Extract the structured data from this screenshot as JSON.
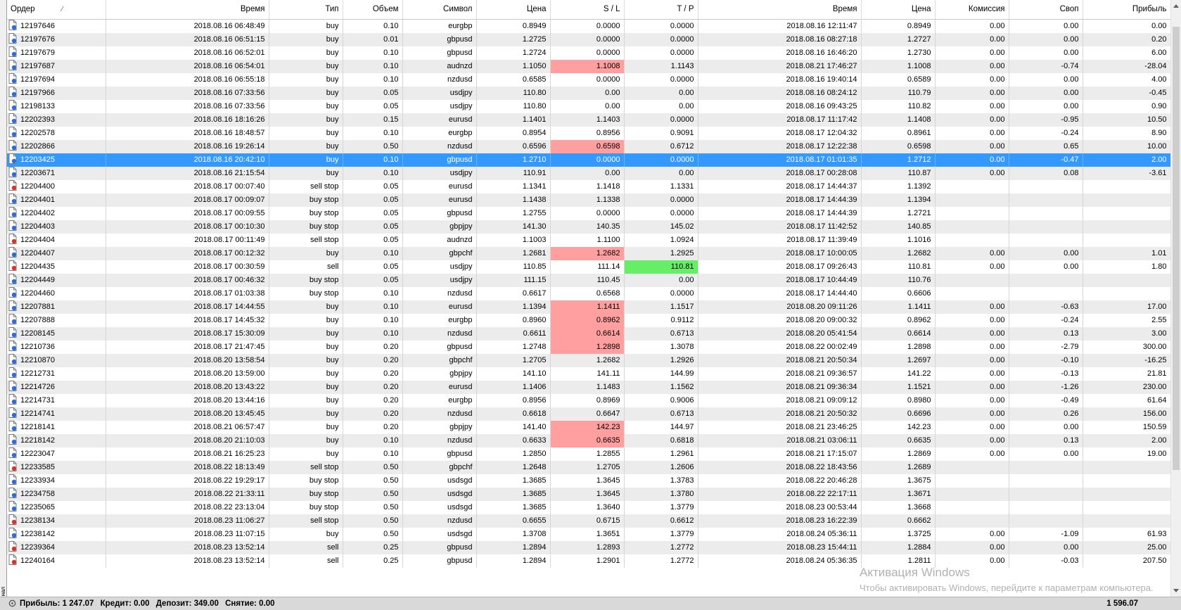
{
  "side_tab": {
    "label": "инал"
  },
  "columns": [
    {
      "key": "order",
      "label": "Ордер",
      "width": 140
    },
    {
      "key": "open_time",
      "label": "Время",
      "width": 232
    },
    {
      "key": "type",
      "label": "Тип",
      "width": 105
    },
    {
      "key": "volume",
      "label": "Объем",
      "width": 85
    },
    {
      "key": "symbol",
      "label": "Символ",
      "width": 105
    },
    {
      "key": "price",
      "label": "Цена",
      "width": 105
    },
    {
      "key": "sl",
      "label": "S / L",
      "width": 105
    },
    {
      "key": "tp",
      "label": "T / P",
      "width": 105
    },
    {
      "key": "close_time",
      "label": "Время",
      "width": 232
    },
    {
      "key": "close_price",
      "label": "Цена",
      "width": 105
    },
    {
      "key": "commission",
      "label": "Комиссия",
      "width": 105
    },
    {
      "key": "swap",
      "label": "Своп",
      "width": 105
    },
    {
      "key": "profit",
      "label": "Прибыль",
      "width": 125
    }
  ],
  "sort_indicator": "⁄",
  "rows": [
    {
      "order": "12197646",
      "open_time": "2018.08.16 06:48:49",
      "type": "buy",
      "volume": "0.10",
      "symbol": "eurgbp",
      "price": "0.8949",
      "sl": "0.0000",
      "tp": "0.0000",
      "close_time": "2018.08.16 12:11:47",
      "close_price": "0.8949",
      "commission": "0.00",
      "swap": "0.00",
      "profit": "0.00"
    },
    {
      "order": "12197676",
      "open_time": "2018.08.16 06:51:15",
      "type": "buy",
      "volume": "0.01",
      "symbol": "gbpusd",
      "price": "1.2725",
      "sl": "0.0000",
      "tp": "0.0000",
      "close_time": "2018.08.16 08:27:18",
      "close_price": "1.2727",
      "commission": "0.00",
      "swap": "0.00",
      "profit": "0.20"
    },
    {
      "order": "12197679",
      "open_time": "2018.08.16 06:52:01",
      "type": "buy",
      "volume": "0.10",
      "symbol": "gbpusd",
      "price": "1.2724",
      "sl": "0.0000",
      "tp": "0.0000",
      "close_time": "2018.08.16 16:46:20",
      "close_price": "1.2730",
      "commission": "0.00",
      "swap": "0.00",
      "profit": "6.00"
    },
    {
      "order": "12197687",
      "open_time": "2018.08.16 06:54:01",
      "type": "buy",
      "volume": "0.10",
      "symbol": "audnzd",
      "price": "1.1050",
      "sl": "1.1008",
      "tp": "1.1143",
      "close_time": "2018.08.21 17:46:27",
      "close_price": "1.1008",
      "commission": "0.00",
      "swap": "-0.74",
      "profit": "-28.04",
      "sl_hl": "red"
    },
    {
      "order": "12197694",
      "open_time": "2018.08.16 06:55:18",
      "type": "buy",
      "volume": "0.10",
      "symbol": "nzdusd",
      "price": "0.6585",
      "sl": "0.0000",
      "tp": "0.0000",
      "close_time": "2018.08.16 19:40:14",
      "close_price": "0.6589",
      "commission": "0.00",
      "swap": "0.00",
      "profit": "4.00"
    },
    {
      "order": "12197966",
      "open_time": "2018.08.16 07:33:56",
      "type": "buy",
      "volume": "0.05",
      "symbol": "usdjpy",
      "price": "110.80",
      "sl": "0.00",
      "tp": "0.00",
      "close_time": "2018.08.16 08:24:12",
      "close_price": "110.79",
      "commission": "0.00",
      "swap": "0.00",
      "profit": "-0.45"
    },
    {
      "order": "12198133",
      "open_time": "2018.08.16 07:33:56",
      "type": "buy",
      "volume": "0.05",
      "symbol": "usdjpy",
      "price": "110.80",
      "sl": "0.00",
      "tp": "0.00",
      "close_time": "2018.08.16 09:43:25",
      "close_price": "110.82",
      "commission": "0.00",
      "swap": "0.00",
      "profit": "0.90"
    },
    {
      "order": "12202393",
      "open_time": "2018.08.16 18:16:26",
      "type": "buy",
      "volume": "0.15",
      "symbol": "eurusd",
      "price": "1.1401",
      "sl": "1.1403",
      "tp": "0.0000",
      "close_time": "2018.08.17 11:17:42",
      "close_price": "1.1408",
      "commission": "0.00",
      "swap": "-0.95",
      "profit": "10.50"
    },
    {
      "order": "12202578",
      "open_time": "2018.08.16 18:48:57",
      "type": "buy",
      "volume": "0.10",
      "symbol": "eurgbp",
      "price": "0.8954",
      "sl": "0.8956",
      "tp": "0.9091",
      "close_time": "2018.08.17 12:04:32",
      "close_price": "0.8961",
      "commission": "0.00",
      "swap": "-0.24",
      "profit": "8.90"
    },
    {
      "order": "12202866",
      "open_time": "2018.08.16 19:26:14",
      "type": "buy",
      "volume": "0.50",
      "symbol": "nzdusd",
      "price": "0.6596",
      "sl": "0.6598",
      "tp": "0.6712",
      "close_time": "2018.08.17 12:22:38",
      "close_price": "0.6598",
      "commission": "0.00",
      "swap": "0.65",
      "profit": "10.00",
      "sl_hl": "red"
    },
    {
      "order": "12203425",
      "open_time": "2018.08.16 20:42:10",
      "type": "buy",
      "volume": "0.10",
      "symbol": "gbpusd",
      "price": "1.2710",
      "sl": "0.0000",
      "tp": "0.0000",
      "close_time": "2018.08.17 01:01:35",
      "close_price": "1.2712",
      "commission": "0.00",
      "swap": "-0.47",
      "profit": "2.00",
      "selected": true
    },
    {
      "order": "12203671",
      "open_time": "2018.08.16 21:15:54",
      "type": "buy",
      "volume": "0.10",
      "symbol": "usdjpy",
      "price": "110.91",
      "sl": "0.00",
      "tp": "0.00",
      "close_time": "2018.08.17 00:28:08",
      "close_price": "110.87",
      "commission": "0.00",
      "swap": "0.08",
      "profit": "-3.61"
    },
    {
      "order": "12204400",
      "open_time": "2018.08.17 00:07:40",
      "type": "sell stop",
      "volume": "0.05",
      "symbol": "eurusd",
      "price": "1.1341",
      "sl": "1.1418",
      "tp": "1.1331",
      "close_time": "2018.08.17 14:44:37",
      "close_price": "1.1392",
      "commission": "",
      "swap": "",
      "profit": ""
    },
    {
      "order": "12204401",
      "open_time": "2018.08.17 00:09:07",
      "type": "buy stop",
      "volume": "0.05",
      "symbol": "eurusd",
      "price": "1.1438",
      "sl": "1.1338",
      "tp": "0.0000",
      "close_time": "2018.08.17 14:44:39",
      "close_price": "1.1394",
      "commission": "",
      "swap": "",
      "profit": ""
    },
    {
      "order": "12204402",
      "open_time": "2018.08.17 00:09:55",
      "type": "buy stop",
      "volume": "0.05",
      "symbol": "gbpusd",
      "price": "1.2755",
      "sl": "0.0000",
      "tp": "0.0000",
      "close_time": "2018.08.17 14:44:39",
      "close_price": "1.2721",
      "commission": "",
      "swap": "",
      "profit": ""
    },
    {
      "order": "12204403",
      "open_time": "2018.08.17 00:10:30",
      "type": "buy stop",
      "volume": "0.05",
      "symbol": "gbpjpy",
      "price": "141.30",
      "sl": "140.35",
      "tp": "145.02",
      "close_time": "2018.08.17 11:42:52",
      "close_price": "140.85",
      "commission": "",
      "swap": "",
      "profit": ""
    },
    {
      "order": "12204404",
      "open_time": "2018.08.17 00:11:49",
      "type": "sell stop",
      "volume": "0.05",
      "symbol": "audnzd",
      "price": "1.1003",
      "sl": "1.1100",
      "tp": "1.0924",
      "close_time": "2018.08.17 11:39:49",
      "close_price": "1.1016",
      "commission": "",
      "swap": "",
      "profit": ""
    },
    {
      "order": "12204407",
      "open_time": "2018.08.17 00:12:32",
      "type": "buy",
      "volume": "0.10",
      "symbol": "gbpchf",
      "price": "1.2681",
      "sl": "1.2682",
      "tp": "1.2925",
      "close_time": "2018.08.17 10:00:05",
      "close_price": "1.2682",
      "commission": "0.00",
      "swap": "0.00",
      "profit": "1.01",
      "sl_hl": "red"
    },
    {
      "order": "12204435",
      "open_time": "2018.08.17 00:30:59",
      "type": "sell",
      "volume": "0.05",
      "symbol": "usdjpy",
      "price": "110.85",
      "sl": "111.14",
      "tp": "110.81",
      "close_time": "2018.08.17 09:26:43",
      "close_price": "110.81",
      "commission": "0.00",
      "swap": "0.00",
      "profit": "1.80",
      "tp_hl": "green"
    },
    {
      "order": "12204449",
      "open_time": "2018.08.17 00:46:32",
      "type": "buy stop",
      "volume": "0.05",
      "symbol": "usdjpy",
      "price": "111.15",
      "sl": "110.45",
      "tp": "0.00",
      "close_time": "2018.08.17 10:44:49",
      "close_price": "110.76",
      "commission": "",
      "swap": "",
      "profit": ""
    },
    {
      "order": "12204460",
      "open_time": "2018.08.17 01:03:38",
      "type": "buy stop",
      "volume": "0.10",
      "symbol": "nzdusd",
      "price": "0.6617",
      "sl": "0.6568",
      "tp": "0.0000",
      "close_time": "2018.08.17 14:44:40",
      "close_price": "0.6606",
      "commission": "",
      "swap": "",
      "profit": ""
    },
    {
      "order": "12207881",
      "open_time": "2018.08.17 14:44:55",
      "type": "buy",
      "volume": "0.10",
      "symbol": "eurusd",
      "price": "1.1394",
      "sl": "1.1411",
      "tp": "1.1517",
      "close_time": "2018.08.20 09:11:26",
      "close_price": "1.1411",
      "commission": "0.00",
      "swap": "-0.63",
      "profit": "17.00",
      "sl_hl": "red"
    },
    {
      "order": "12207888",
      "open_time": "2018.08.17 14:45:32",
      "type": "buy",
      "volume": "0.10",
      "symbol": "eurgbp",
      "price": "0.8960",
      "sl": "0.8962",
      "tp": "0.9112",
      "close_time": "2018.08.20 09:00:32",
      "close_price": "0.8962",
      "commission": "0.00",
      "swap": "-0.24",
      "profit": "2.55",
      "sl_hl": "red"
    },
    {
      "order": "12208145",
      "open_time": "2018.08.17 15:30:09",
      "type": "buy",
      "volume": "0.10",
      "symbol": "nzdusd",
      "price": "0.6611",
      "sl": "0.6614",
      "tp": "0.6713",
      "close_time": "2018.08.20 05:41:54",
      "close_price": "0.6614",
      "commission": "0.00",
      "swap": "0.13",
      "profit": "3.00",
      "sl_hl": "red"
    },
    {
      "order": "12210736",
      "open_time": "2018.08.17 21:47:45",
      "type": "buy",
      "volume": "0.20",
      "symbol": "gbpusd",
      "price": "1.2748",
      "sl": "1.2898",
      "tp": "1.3078",
      "close_time": "2018.08.22 00:02:49",
      "close_price": "1.2898",
      "commission": "0.00",
      "swap": "-2.79",
      "profit": "300.00",
      "sl_hl": "red"
    },
    {
      "order": "12210870",
      "open_time": "2018.08.20 13:58:54",
      "type": "buy",
      "volume": "0.20",
      "symbol": "gbpchf",
      "price": "1.2705",
      "sl": "1.2682",
      "tp": "1.2926",
      "close_time": "2018.08.21 20:50:34",
      "close_price": "1.2697",
      "commission": "0.00",
      "swap": "-0.10",
      "profit": "-16.25"
    },
    {
      "order": "12212731",
      "open_time": "2018.08.20 13:59:00",
      "type": "buy",
      "volume": "0.20",
      "symbol": "gbpjpy",
      "price": "141.10",
      "sl": "141.11",
      "tp": "144.99",
      "close_time": "2018.08.21 09:36:57",
      "close_price": "141.22",
      "commission": "0.00",
      "swap": "-0.13",
      "profit": "21.81"
    },
    {
      "order": "12214726",
      "open_time": "2018.08.20 13:43:22",
      "type": "buy",
      "volume": "0.20",
      "symbol": "eurusd",
      "price": "1.1406",
      "sl": "1.1483",
      "tp": "1.1562",
      "close_time": "2018.08.21 09:36:34",
      "close_price": "1.1521",
      "commission": "0.00",
      "swap": "-1.26",
      "profit": "230.00"
    },
    {
      "order": "12214731",
      "open_time": "2018.08.20 13:44:16",
      "type": "buy",
      "volume": "0.20",
      "symbol": "eurgbp",
      "price": "0.8956",
      "sl": "0.8969",
      "tp": "0.9006",
      "close_time": "2018.08.21 09:09:12",
      "close_price": "0.8980",
      "commission": "0.00",
      "swap": "-0.49",
      "profit": "61.64"
    },
    {
      "order": "12214741",
      "open_time": "2018.08.20 13:45:45",
      "type": "buy",
      "volume": "0.20",
      "symbol": "nzdusd",
      "price": "0.6618",
      "sl": "0.6647",
      "tp": "0.6713",
      "close_time": "2018.08.21 20:50:32",
      "close_price": "0.6696",
      "commission": "0.00",
      "swap": "0.26",
      "profit": "156.00"
    },
    {
      "order": "12218141",
      "open_time": "2018.08.21 06:57:47",
      "type": "buy",
      "volume": "0.20",
      "symbol": "gbpjpy",
      "price": "141.40",
      "sl": "142.23",
      "tp": "144.97",
      "close_time": "2018.08.21 23:46:25",
      "close_price": "142.23",
      "commission": "0.00",
      "swap": "0.00",
      "profit": "150.59",
      "sl_hl": "red"
    },
    {
      "order": "12218142",
      "open_time": "2018.08.20 21:10:03",
      "type": "buy",
      "volume": "0.10",
      "symbol": "nzdusd",
      "price": "0.6633",
      "sl": "0.6635",
      "tp": "0.6818",
      "close_time": "2018.08.21 03:06:11",
      "close_price": "0.6635",
      "commission": "0.00",
      "swap": "0.13",
      "profit": "2.00",
      "sl_hl": "red"
    },
    {
      "order": "12223047",
      "open_time": "2018.08.21 16:25:23",
      "type": "buy",
      "volume": "0.10",
      "symbol": "gbpusd",
      "price": "1.2850",
      "sl": "1.2855",
      "tp": "1.2961",
      "close_time": "2018.08.21 17:15:07",
      "close_price": "1.2869",
      "commission": "0.00",
      "swap": "0.00",
      "profit": "19.00"
    },
    {
      "order": "12233585",
      "open_time": "2018.08.22 18:13:49",
      "type": "sell stop",
      "volume": "0.50",
      "symbol": "gbpchf",
      "price": "1.2648",
      "sl": "1.2705",
      "tp": "1.2606",
      "close_time": "2018.08.22 18:43:56",
      "close_price": "1.2689",
      "commission": "",
      "swap": "",
      "profit": ""
    },
    {
      "order": "12233934",
      "open_time": "2018.08.22 19:29:17",
      "type": "buy stop",
      "volume": "0.50",
      "symbol": "usdsgd",
      "price": "1.3685",
      "sl": "1.3645",
      "tp": "1.3783",
      "close_time": "2018.08.22 20:46:28",
      "close_price": "1.3675",
      "commission": "",
      "swap": "",
      "profit": ""
    },
    {
      "order": "12234758",
      "open_time": "2018.08.22 21:33:11",
      "type": "buy stop",
      "volume": "0.50",
      "symbol": "usdsgd",
      "price": "1.3685",
      "sl": "1.3645",
      "tp": "1.3780",
      "close_time": "2018.08.22 22:17:11",
      "close_price": "1.3671",
      "commission": "",
      "swap": "",
      "profit": ""
    },
    {
      "order": "12235065",
      "open_time": "2018.08.22 23:13:04",
      "type": "buy stop",
      "volume": "0.50",
      "symbol": "usdsgd",
      "price": "1.3685",
      "sl": "1.3640",
      "tp": "1.3779",
      "close_time": "2018.08.23 00:53:44",
      "close_price": "1.3668",
      "commission": "",
      "swap": "",
      "profit": ""
    },
    {
      "order": "12238134",
      "open_time": "2018.08.23 11:06:27",
      "type": "sell stop",
      "volume": "0.50",
      "symbol": "nzdusd",
      "price": "0.6655",
      "sl": "0.6715",
      "tp": "0.6612",
      "close_time": "2018.08.23 16:22:39",
      "close_price": "0.6662",
      "commission": "",
      "swap": "",
      "profit": ""
    },
    {
      "order": "12238142",
      "open_time": "2018.08.23 11:07:15",
      "type": "buy",
      "volume": "0.50",
      "symbol": "usdsgd",
      "price": "1.3708",
      "sl": "1.3651",
      "tp": "1.3779",
      "close_time": "2018.08.24 05:36:11",
      "close_price": "1.3725",
      "commission": "0.00",
      "swap": "-1.09",
      "profit": "61.93"
    },
    {
      "order": "12239364",
      "open_time": "2018.08.23 13:52:14",
      "type": "sell",
      "volume": "0.25",
      "symbol": "gbpusd",
      "price": "1.2894",
      "sl": "1.2893",
      "tp": "1.2772",
      "close_time": "2018.08.23 15:44:11",
      "close_price": "1.2884",
      "commission": "0.00",
      "swap": "0.00",
      "profit": "25.00"
    },
    {
      "order": "12240164",
      "open_time": "2018.08.23 13:52:14",
      "type": "sell",
      "volume": "0.25",
      "symbol": "gbpusd",
      "price": "1.2894",
      "sl": "1.2901",
      "tp": "1.2772",
      "close_time": "2018.08.24 05:36:35",
      "close_price": "1.2811",
      "commission": "0.00",
      "swap": "-0.03",
      "profit": "207.50"
    }
  ],
  "status": {
    "profit": "Прибыль: 1 247.07",
    "credit": "Кредит: 0.00",
    "deposit": "Депозит: 349.00",
    "withdrawal": "Снятие: 0.00",
    "total": "1 596.07"
  },
  "watermark": {
    "title": "Активация Windows",
    "body": "Чтобы активировать Windows, перейдите к параметрам компьютера."
  },
  "colors": {
    "selected_row": "#3399ff",
    "sl_hit": "#ff9f9f",
    "tp_hit": "#66ee66",
    "icon_buy": "#2b6fd6",
    "icon_sell": "#d9342b"
  }
}
